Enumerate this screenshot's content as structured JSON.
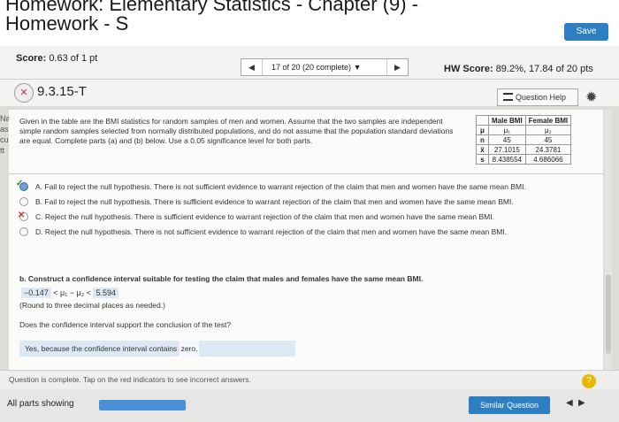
{
  "header": {
    "title": "Homework: Elementary Statistics - Chapter (9) - Homework - S",
    "save_label": "Save"
  },
  "score_bar": {
    "score_label": "Score:",
    "score_value": "0.63 of 1 pt",
    "nav_label": "17 of 20 (20 complete)",
    "nav_dropdown": "▼",
    "prev": "◀",
    "next": "▶",
    "hw_label": "HW Score:",
    "hw_value": "89.2%, 17.84 of 20 pts"
  },
  "question": {
    "id": "9.3.15-T",
    "help_label": "Question Help",
    "text": "Given in the table are the BMI statistics for random samples of men and women. Assume that the two samples are independent simple random samples selected from normally distributed populations, and do not assume that the population standard deviations are equal. Complete parts (a) and (b) below. Use a 0.05 significance level for both parts."
  },
  "side_letters": [
    "Na",
    "as",
    "cu",
    "",
    "",
    "tt"
  ],
  "table": {
    "headers": [
      "",
      "Male BMI",
      "Female BMI"
    ],
    "rows": [
      [
        "μ",
        "μ₁",
        "μ₂"
      ],
      [
        "n",
        "45",
        "45"
      ],
      [
        "x̄",
        "27.1015",
        "24.3781"
      ],
      [
        "s",
        "8.438554",
        "4.686066"
      ]
    ]
  },
  "options": [
    {
      "letter": "A.",
      "text": "Fail to reject the null hypothesis. There is not sufficient evidence to warrant rejection of the claim that men and women have the same mean BMI."
    },
    {
      "letter": "B.",
      "text": "Fail to reject the null hypothesis. There is sufficient evidence to warrant rejection of the claim that men and women have the same mean BMI."
    },
    {
      "letter": "C.",
      "text": "Reject the null hypothesis. There is sufficient evidence to warrant rejection of the claim that men and women have the same mean BMI."
    },
    {
      "letter": "D.",
      "text": "Reject the null hypothesis. There is not sufficient evidence to warrant rejection of the claim that men and women have the same mean BMI."
    }
  ],
  "part_b": {
    "prompt": "b. Construct a confidence interval suitable for testing the claim that males and females have the same mean BMI.",
    "lower": "−0.147",
    "middle": "< μ₁ − μ₂ <",
    "upper": "5.594",
    "round_note": "(Round to three decimal places as needed.)",
    "question2": "Does the confidence interval support the conclusion of the test?",
    "answer_prefix": "Yes,",
    "answer_mid": "because the confidence interval contains",
    "answer_value": "zero."
  },
  "status": {
    "text": "Question is complete. Tap on the red indicators to see incorrect answers.",
    "help_icon": "?"
  },
  "footer": {
    "all_parts": "All parts showing",
    "similar_label": "Similar Question",
    "prev": "◀",
    "next": "▶"
  }
}
